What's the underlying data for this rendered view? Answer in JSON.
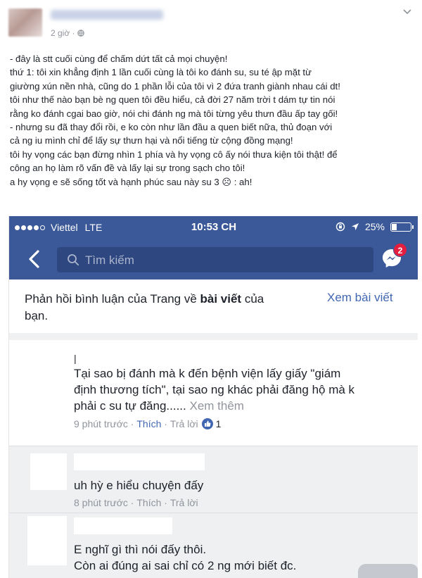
{
  "post": {
    "time": "2 giờ · ",
    "lines": [
      "- đây là stt cuối cùng để chấm dứt tất cả mọi chuyện!",
      "thứ 1: tôi xin khẳng định 1 lần cuối cùng là tôi ko đánh su, su té ập mặt từ",
      "giường xún nền nhà, cũng do 1 phần lỗi của tôi vì 2 đứa tranh giành nhau cái dt!",
      "tôi như thế nào bạn bè ng quen tôi đều hiểu, cả đời 27 năm trời t dám tự tin nói",
      "rằng ko đánh cgai bao giờ, nói chi đánh ng mà tôi từng yêu thưn đầu ấp tay gối!",
      "- nhưng su đã thay đổi rồi, e ko còn như lần đầu a quen biết nữa, thủ đoạn với",
      "cả ng iu mình chỉ để lấy sự thưn hại và nổi tiếng từ cộng đồng mạng!",
      "tôi hy vọng các bạn đừng nhìn 1 phía và hy vọng cô ấy nói thưa kiện tôi thật! để",
      "công an họ làm rõ vấn đề và lấy lại sự trong sạch cho tôi!",
      "a hy vọng e sẽ sống tốt và hạnh phúc sau này su 3 ☹ : ah!"
    ]
  },
  "phone": {
    "carrier": "Viettel",
    "network": "LTE",
    "time": "10:53 CH",
    "battery": "25%",
    "battery_level": 0.25,
    "search_placeholder": "Tìm kiếm",
    "messenger_badge": "2",
    "notice_prefix": "Phản hồi bình luận của Trang về ",
    "notice_bold": "bài viết",
    "notice_suffix": " của",
    "notice_line2": "bạn.",
    "notice_link": "Xem bài viết"
  },
  "comments": [
    {
      "cursor": "|",
      "lines": [
        "Tại sao bị đánh mà k đến bệnh viện lấy giấy \"giám",
        "định thương tích\", tại sao ng khác phải đăng hộ mà k"
      ],
      "last_line": "phải c su tự đăng......",
      "see_more": "Xem thêm",
      "time": "9 phút trước",
      "like": "Thích",
      "reply": "Trả lời",
      "like_count": "1"
    },
    {
      "lines": [
        "uh hỳ e hiểu chuyện đấy"
      ],
      "time": "8 phút trước",
      "like": "Thích",
      "reply": "Trả lời"
    },
    {
      "lines": [
        "E nghĩ gì thì nói đấy thôi.",
        "Còn ai đúng ai sai chỉ có 2 ng mới biết đc."
      ]
    }
  ]
}
